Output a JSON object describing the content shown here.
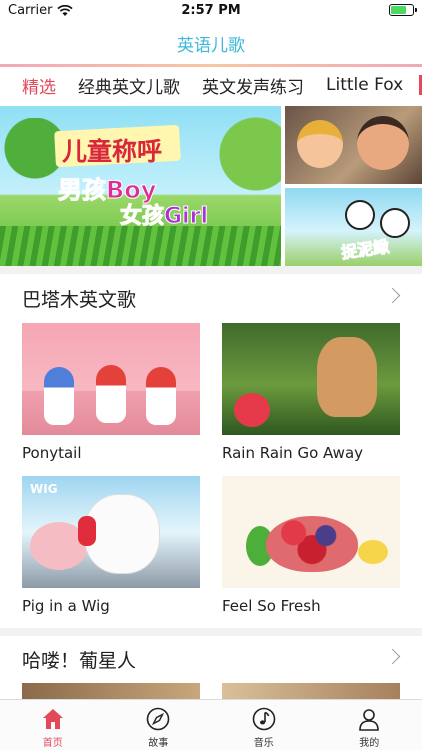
{
  "status_bar": {
    "carrier": "Carrier",
    "time": "2:57 PM"
  },
  "nav": {
    "title": "英语儿歌"
  },
  "tabs": [
    {
      "label": "精选",
      "active": true
    },
    {
      "label": "经典英文儿歌",
      "active": false
    },
    {
      "label": "英文发声练习",
      "active": false
    },
    {
      "label": "Little Fox",
      "active": false
    }
  ],
  "banner": {
    "main_title": "儿童称呼",
    "main_line2": "男孩Boy",
    "main_line3": "女孩Girl",
    "side_bottom_word": "捉泥鳅"
  },
  "sections": [
    {
      "title": "巴塔木英文歌",
      "items": [
        {
          "label": "Ponytail"
        },
        {
          "label": "Rain Rain Go Away"
        },
        {
          "label": "Pig in a Wig"
        },
        {
          "label": "Feel So Fresh"
        }
      ]
    },
    {
      "title": "哈喽！葡星人",
      "items": []
    }
  ],
  "thumb_text": {
    "wig": "WIG"
  },
  "tab_bar": [
    {
      "label": "首页",
      "icon": "home-icon",
      "active": true
    },
    {
      "label": "故事",
      "icon": "compass-icon",
      "active": false
    },
    {
      "label": "音乐",
      "icon": "music-note-icon",
      "active": false
    },
    {
      "label": "我的",
      "icon": "profile-icon",
      "active": false
    }
  ],
  "colors": {
    "accent": "#e24a5a",
    "title": "#3fb8dc"
  }
}
